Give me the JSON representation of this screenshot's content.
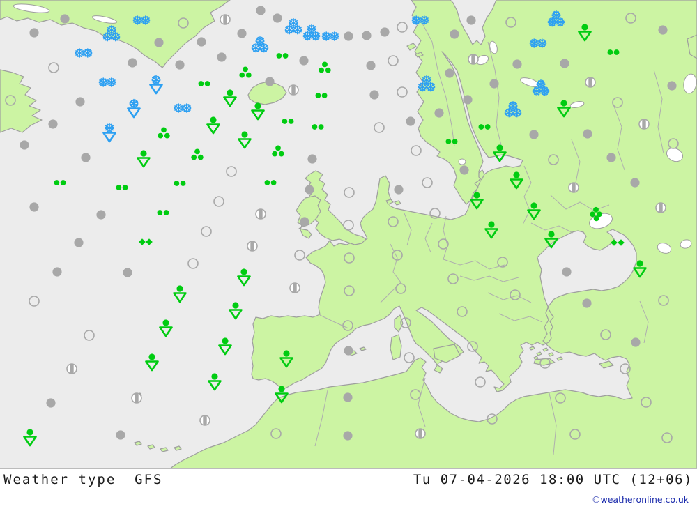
{
  "caption": {
    "left": "Weather type  GFS",
    "right": "Tu 07-04-2026 18:00 UTC (12+06)",
    "credit": "©weatheronline.co.uk"
  },
  "colors": {
    "sea": "#ececec",
    "land": "#ccf4a3",
    "coast": "#9e9e9e",
    "border": "#aeaeae",
    "lake": "#ffffff",
    "symbol_gray": "#a8a8a8",
    "symbol_green": "#00cc11",
    "symbol_blue": "#2da0f2",
    "caption_text": "#1a1a1a",
    "credit_text": "#1b2bac"
  },
  "symbol_legend": {
    "c": "cloudy-filled-gray-circle",
    "o": "clear-open-circle",
    "p": "partly-cloudy-circle-with-bar",
    "r2": "light-rain-two-dots",
    "r3": "rain-three-dots",
    "r4": "heavy-rain-four-dots",
    "d2": "drizzle-two-diamonds",
    "rs": "rain-shower-dot-over-triangle",
    "s2": "snow-two-flakes",
    "s3": "snow-three-flakes",
    "ss": "snow-shower-flake-over-triangle"
  },
  "markers": [
    [
      "s2",
      203,
      29
    ],
    [
      "s2",
      120,
      76
    ],
    [
      "s2",
      154,
      118
    ],
    [
      "s2",
      262,
      155
    ],
    [
      "s2",
      474,
      52
    ],
    [
      "s2",
      603,
      29
    ],
    [
      "s2",
      772,
      62
    ],
    [
      "s3",
      160,
      48
    ],
    [
      "s3",
      421,
      38
    ],
    [
      "s3",
      447,
      47
    ],
    [
      "s3",
      373,
      64
    ],
    [
      "s3",
      798,
      27
    ],
    [
      "s3",
      612,
      120
    ],
    [
      "s3",
      776,
      126
    ],
    [
      "s3",
      736,
      157
    ],
    [
      "ss",
      224,
      123
    ],
    [
      "ss",
      192,
      157
    ],
    [
      "ss",
      157,
      192
    ],
    [
      "rs",
      839,
      47
    ],
    [
      "rs",
      330,
      141
    ],
    [
      "rs",
      370,
      160
    ],
    [
      "rs",
      306,
      180
    ],
    [
      "rs",
      351,
      201
    ],
    [
      "rs",
      206,
      228
    ],
    [
      "rs",
      809,
      156
    ],
    [
      "rs",
      717,
      220
    ],
    [
      "rs",
      741,
      259
    ],
    [
      "rs",
      684,
      288
    ],
    [
      "rs",
      766,
      303
    ],
    [
      "rs",
      705,
      330
    ],
    [
      "rs",
      791,
      344
    ],
    [
      "rs",
      918,
      386
    ],
    [
      "rs",
      350,
      398
    ],
    [
      "rs",
      258,
      422
    ],
    [
      "rs",
      338,
      446
    ],
    [
      "rs",
      238,
      471
    ],
    [
      "rs",
      323,
      497
    ],
    [
      "rs",
      218,
      520
    ],
    [
      "rs",
      308,
      548
    ],
    [
      "rs",
      411,
      515
    ],
    [
      "rs",
      404,
      566
    ],
    [
      "rs",
      43,
      628
    ],
    [
      "r2",
      405,
      80
    ],
    [
      "r2",
      293,
      120
    ],
    [
      "r2",
      461,
      137
    ],
    [
      "r2",
      413,
      174
    ],
    [
      "r2",
      456,
      182
    ],
    [
      "r2",
      880,
      75
    ],
    [
      "r2",
      695,
      182
    ],
    [
      "r2",
      648,
      203
    ],
    [
      "r2",
      86,
      262
    ],
    [
      "r2",
      175,
      269
    ],
    [
      "r2",
      258,
      263
    ],
    [
      "r2",
      388,
      262
    ],
    [
      "r2",
      234,
      305
    ],
    [
      "d2",
      209,
      347
    ],
    [
      "d2",
      886,
      348
    ],
    [
      "r3",
      352,
      104
    ],
    [
      "r3",
      466,
      97
    ],
    [
      "r3",
      235,
      191
    ],
    [
      "r3",
      283,
      222
    ],
    [
      "r3",
      399,
      217
    ],
    [
      "r4",
      855,
      307
    ],
    [
      "c",
      93,
      27
    ],
    [
      "c",
      49,
      47
    ],
    [
      "c",
      374,
      15
    ],
    [
      "c",
      398,
      26
    ],
    [
      "c",
      347,
      48
    ],
    [
      "c",
      228,
      61
    ],
    [
      "c",
      289,
      60
    ],
    [
      "c",
      190,
      90
    ],
    [
      "c",
      258,
      93
    ],
    [
      "c",
      318,
      82
    ],
    [
      "c",
      387,
      117
    ],
    [
      "c",
      436,
      87
    ],
    [
      "c",
      115,
      146
    ],
    [
      "c",
      76,
      178
    ],
    [
      "c",
      35,
      208
    ],
    [
      "c",
      123,
      226
    ],
    [
      "c",
      448,
      228
    ],
    [
      "c",
      500,
      52
    ],
    [
      "c",
      526,
      51
    ],
    [
      "c",
      552,
      46
    ],
    [
      "c",
      676,
      29
    ],
    [
      "c",
      652,
      49
    ],
    [
      "c",
      951,
      43
    ],
    [
      "c",
      742,
      92
    ],
    [
      "c",
      810,
      91
    ],
    [
      "c",
      532,
      94
    ],
    [
      "c",
      645,
      105
    ],
    [
      "c",
      709,
      120
    ],
    [
      "c",
      537,
      136
    ],
    [
      "c",
      671,
      143
    ],
    [
      "c",
      630,
      162
    ],
    [
      "c",
      589,
      174
    ],
    [
      "c",
      766,
      193
    ],
    [
      "c",
      843,
      192
    ],
    [
      "c",
      877,
      226
    ],
    [
      "c",
      666,
      244
    ],
    [
      "c",
      964,
      123
    ],
    [
      "c",
      444,
      272
    ],
    [
      "c",
      437,
      318
    ],
    [
      "c",
      572,
      272
    ],
    [
      "c",
      49,
      297
    ],
    [
      "c",
      145,
      308
    ],
    [
      "c",
      113,
      348
    ],
    [
      "c",
      82,
      390
    ],
    [
      "c",
      183,
      391
    ],
    [
      "c",
      911,
      262
    ],
    [
      "c",
      813,
      390
    ],
    [
      "c",
      842,
      435
    ],
    [
      "c",
      73,
      578
    ],
    [
      "c",
      173,
      624
    ],
    [
      "c",
      500,
      503
    ],
    [
      "c",
      499,
      570
    ],
    [
      "c",
      499,
      625
    ],
    [
      "c",
      912,
      491
    ],
    [
      "o",
      263,
      33
    ],
    [
      "o",
      577,
      39
    ],
    [
      "o",
      733,
      32
    ],
    [
      "o",
      905,
      26
    ],
    [
      "o",
      77,
      97
    ],
    [
      "o",
      15,
      144
    ],
    [
      "o",
      564,
      87
    ],
    [
      "o",
      577,
      132
    ],
    [
      "o",
      544,
      183
    ],
    [
      "o",
      597,
      216
    ],
    [
      "o",
      794,
      229
    ],
    [
      "o",
      966,
      206
    ],
    [
      "o",
      886,
      147
    ],
    [
      "o",
      613,
      262
    ],
    [
      "o",
      624,
      306
    ],
    [
      "o",
      564,
      318
    ],
    [
      "o",
      501,
      276
    ],
    [
      "o",
      500,
      323
    ],
    [
      "o",
      430,
      366
    ],
    [
      "o",
      314,
      289
    ],
    [
      "o",
      296,
      332
    ],
    [
      "o",
      277,
      378
    ],
    [
      "o",
      49,
      432
    ],
    [
      "o",
      128,
      481
    ],
    [
      "o",
      570,
      366
    ],
    [
      "o",
      501,
      370
    ],
    [
      "o",
      501,
      417
    ],
    [
      "o",
      499,
      467
    ],
    [
      "o",
      575,
      414
    ],
    [
      "o",
      582,
      463
    ],
    [
      "o",
      636,
      350
    ],
    [
      "o",
      650,
      400
    ],
    [
      "o",
      663,
      447
    ],
    [
      "o",
      721,
      376
    ],
    [
      "o",
      739,
      423
    ],
    [
      "o",
      396,
      622
    ],
    [
      "o",
      587,
      513
    ],
    [
      "o",
      678,
      497
    ],
    [
      "o",
      689,
      548
    ],
    [
      "o",
      782,
      521
    ],
    [
      "o",
      596,
      566
    ],
    [
      "o",
      706,
      601
    ],
    [
      "o",
      804,
      571
    ],
    [
      "o",
      825,
      623
    ],
    [
      "o",
      897,
      529
    ],
    [
      "o",
      927,
      577
    ],
    [
      "o",
      957,
      628
    ],
    [
      "o",
      869,
      480
    ],
    [
      "o",
      952,
      431
    ],
    [
      "o",
      332,
      246
    ],
    [
      "p",
      323,
      28
    ],
    [
      "p",
      421,
      129
    ],
    [
      "p",
      374,
      307
    ],
    [
      "p",
      362,
      353
    ],
    [
      "p",
      423,
      413
    ],
    [
      "p",
      679,
      85
    ],
    [
      "p",
      847,
      118
    ],
    [
      "p",
      924,
      178
    ],
    [
      "p",
      948,
      298
    ],
    [
      "p",
      823,
      269
    ],
    [
      "p",
      103,
      529
    ],
    [
      "p",
      196,
      571
    ],
    [
      "p",
      294,
      603
    ],
    [
      "p",
      603,
      622
    ]
  ]
}
